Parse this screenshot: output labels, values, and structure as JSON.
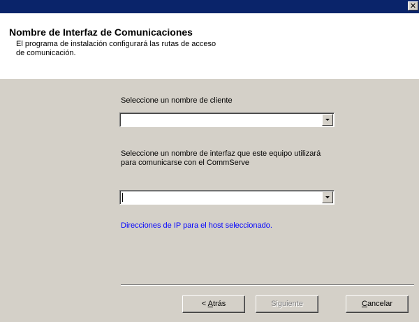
{
  "titlebar": {
    "close_label": "✕"
  },
  "header": {
    "title": "Nombre de Interfaz de Comunicaciones",
    "subtitle": "El programa de instalación configurará las rutas de acceso de comunicación."
  },
  "client": {
    "label": "Seleccione un nombre de cliente",
    "value": ""
  },
  "interface": {
    "label_line1": "Seleccione un nombre de interfaz que este equipo utilizará",
    "label_line2": "para comunicarse con el CommServe",
    "value": ""
  },
  "ip_text": "Direcciones de IP para el host seleccionado.",
  "buttons": {
    "back_prefix": "< ",
    "back_mnemonic": "A",
    "back_rest": "trás",
    "next": "Siguiente",
    "cancel_mnemonic": "C",
    "cancel_rest": "ancelar"
  }
}
